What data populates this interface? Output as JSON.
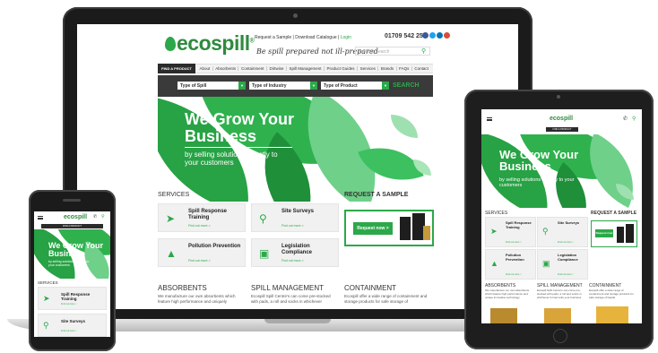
{
  "laptop": {
    "brand": "ecospill",
    "brand_sub": "",
    "top_links": "Request a Sample | Download Catalogue |",
    "login": "Login",
    "phone": "01709 542 259",
    "tagline": "Be spill prepared not ill-prepared",
    "search_placeholder": "Product Search",
    "nav": {
      "find": "FIND A PRODUCT",
      "items": [
        "About",
        "Absorbents",
        "Containment",
        "Dirtwise",
        "Spill Management",
        "Product Guides",
        "Services",
        "Brands",
        "FAQs",
        "Contact"
      ]
    },
    "filters": {
      "spill": "Type of Spill",
      "industry": "Type of Industry",
      "product": "Type of Product",
      "search": "SEARCH"
    },
    "hero": {
      "title": "We Grow Your Business",
      "subtitle": "by selling solutions directly to your customers"
    },
    "services_title": "SERVICES",
    "services": [
      {
        "title": "Spill Response Training",
        "link": "Find out more >"
      },
      {
        "title": "Site Surveys",
        "link": "Find out more >"
      },
      {
        "title": "Pollution Prevention",
        "link": "Find out more >"
      },
      {
        "title": "Legislation Compliance",
        "link": "Find out more >"
      }
    ],
    "sample_title": "REQUEST A SAMPLE",
    "sample_button": "Request now >",
    "columns": [
      {
        "title": "ABSORBENTS",
        "text": "We manufacture our own absorbents which feature high performance and uniquely"
      },
      {
        "title": "SPILL MANAGEMENT",
        "text": "Ecospill Spill Centre's can come pre-stocked with pads, a roll and socks in whichever"
      },
      {
        "title": "CONTAINMENT",
        "text": "Ecospill offer a wide range of containment and storage products for safe storage of"
      }
    ]
  },
  "tablet": {
    "brand": "ecospill",
    "find": "FIND A PRODUCT",
    "hero_title": "We Grow Your Business",
    "hero_sub": "by selling solutions directly to your customers",
    "services_title": "SERVICES",
    "sample_title": "REQUEST A SAMPLE",
    "sample_button": "Request now",
    "services": [
      {
        "title": "Spill Response Training",
        "link": "Find out more >"
      },
      {
        "title": "Site Surveys",
        "link": "Find out more >"
      },
      {
        "title": "Pollution Prevention",
        "link": "Find out more >"
      },
      {
        "title": "Legislation Compliance",
        "link": "Find out more >"
      }
    ],
    "columns": [
      {
        "title": "ABSORBENTS",
        "text": "We manufacture our own absorbents which feature high performance and unique innovative technology"
      },
      {
        "title": "SPILL MANAGEMENT",
        "text": "Ecospill Spill Centre's can come pre-stocked with pads, a roll and socks in whichever format suits your business"
      },
      {
        "title": "CONTAINMENT",
        "text": "Ecospill offer a wide range of containment and storage products for safe storage of liquids"
      }
    ]
  },
  "phone": {
    "brand": "ecospill",
    "find": "FIND A PRODUCT",
    "hero_title": "We Grow Your Business",
    "hero_sub": "by selling solutions directly to your customers",
    "services_title": "SERVICES",
    "services": [
      {
        "title": "Spill Response Training",
        "link": "Find out more >"
      },
      {
        "title": "Site Surveys",
        "link": "Find out more >"
      }
    ]
  },
  "colors": {
    "brand_green": "#2ca84a",
    "dark": "#2b2b2b"
  }
}
